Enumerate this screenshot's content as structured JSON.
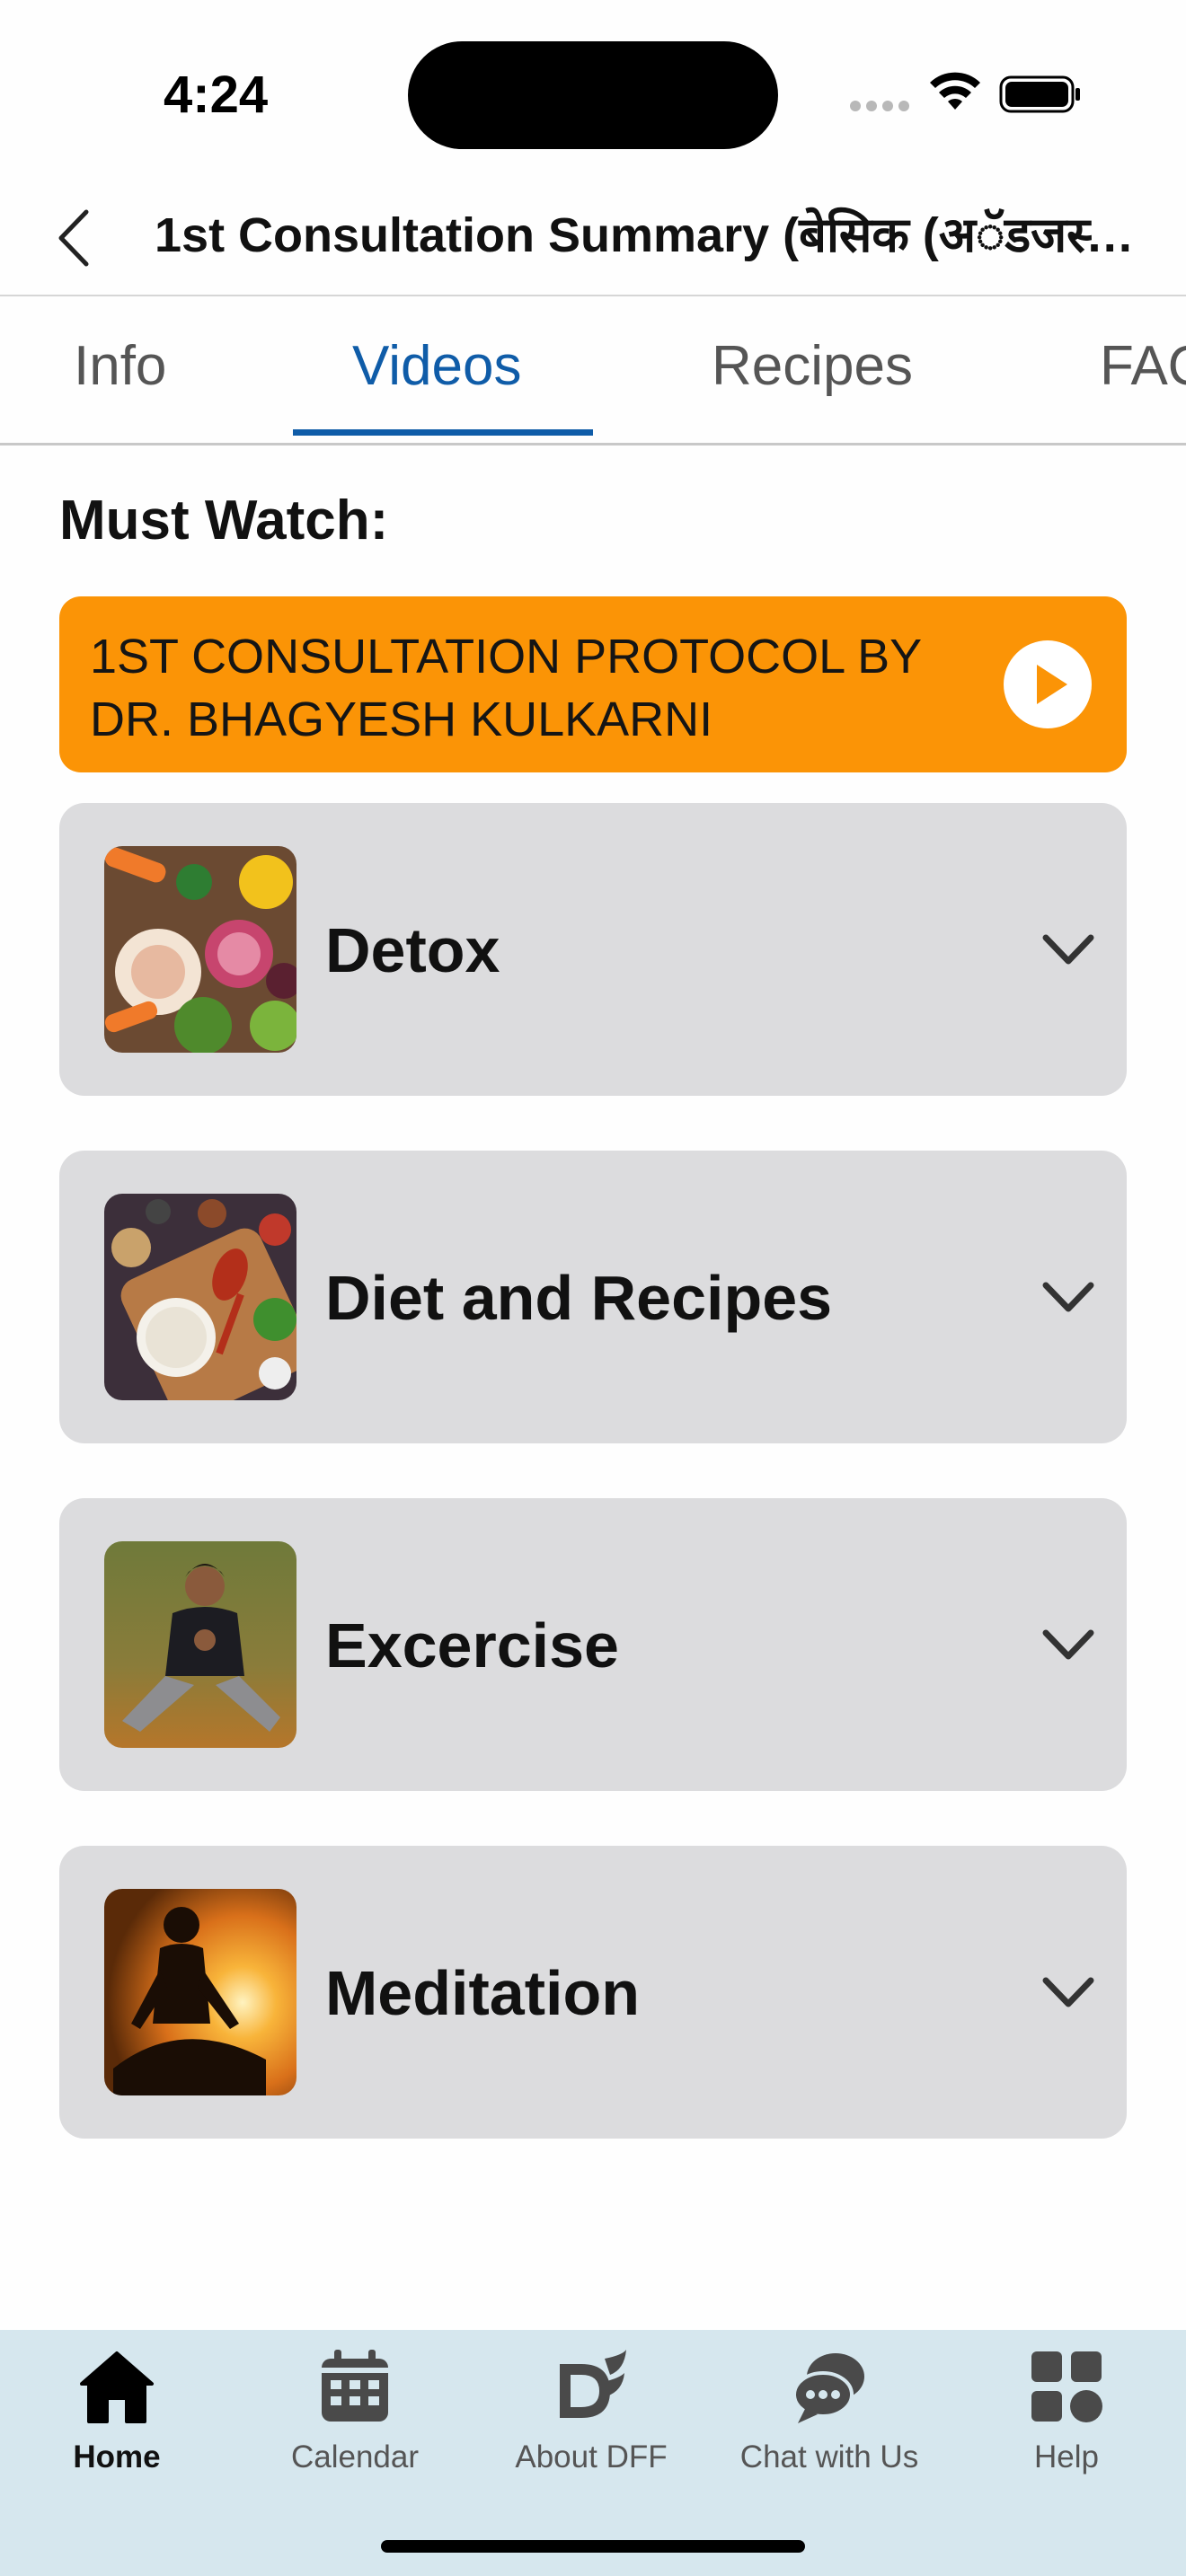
{
  "status_bar": {
    "time": "4:24"
  },
  "header": {
    "title": "1st Consultation Summary (बेसिक (अॅडजस्ट..."
  },
  "tabs": [
    {
      "label": "Info",
      "active": false
    },
    {
      "label": "Videos",
      "active": true
    },
    {
      "label": "Recipes",
      "active": false
    },
    {
      "label": "FAQ",
      "active": false
    }
  ],
  "section": {
    "heading": "Must Watch:"
  },
  "must_watch": {
    "label": "1ST CONSULTATION PROTOCOL BY DR. BHAGYESH KULKARNI",
    "icon": "play-circle-icon"
  },
  "categories": [
    {
      "label": "Detox",
      "icon": "chevron-down-icon"
    },
    {
      "label": "Diet and Recipes",
      "icon": "chevron-down-icon"
    },
    {
      "label": "Excercise",
      "icon": "chevron-down-icon"
    },
    {
      "label": "Meditation",
      "icon": "chevron-down-icon"
    }
  ],
  "bottom_nav": [
    {
      "label": "Home",
      "icon": "home-icon",
      "active": true
    },
    {
      "label": "Calendar",
      "icon": "calendar-icon",
      "active": false
    },
    {
      "label": "About DFF",
      "icon": "dff-logo-icon",
      "active": false
    },
    {
      "label": "Chat with Us",
      "icon": "chat-icon",
      "active": false
    },
    {
      "label": "Help",
      "icon": "grid-icon",
      "active": false
    }
  ],
  "colors": {
    "accent": "#0f5ca8",
    "banner": "#fb9406",
    "card": "#dcdcde",
    "bottom_bar": "#d6e7ee"
  }
}
